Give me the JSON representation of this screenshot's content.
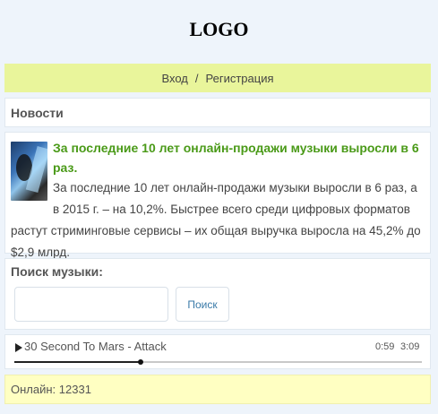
{
  "header": {
    "logo": "LOGO"
  },
  "auth": {
    "login_label": "Вход",
    "separator": "/",
    "register_label": "Регистрация"
  },
  "news": {
    "heading": "Новости",
    "article": {
      "title": "За последние 10 лет онлайн-продажи музыки выросли в 6 раз.",
      "text": "За последние 10 лет онлайн-продажи музыки выросли в 6 раз, а в 2015 г. – на 10,2%. Быстрее всего среди цифровых форматов растут стриминговые сервисы – их общая выручка выросла на 45,2% до $2,9 млрд."
    }
  },
  "search": {
    "label": "Поиск музыки:",
    "input_value": "",
    "placeholder": "",
    "button_label": "Поиск"
  },
  "player": {
    "track": "30 Second To Mars - Attack",
    "current_time": "0:59",
    "total_time": "3:09",
    "progress": 0.31
  },
  "footer": {
    "online_text": "Онлайн: 12331"
  },
  "colors": {
    "auth_bar": "#e9f59b",
    "news_title": "#4a9a18",
    "online_bar": "#ffffc2"
  },
  "icons": {
    "play": "play-icon",
    "news_image": "news-thumbnail"
  }
}
